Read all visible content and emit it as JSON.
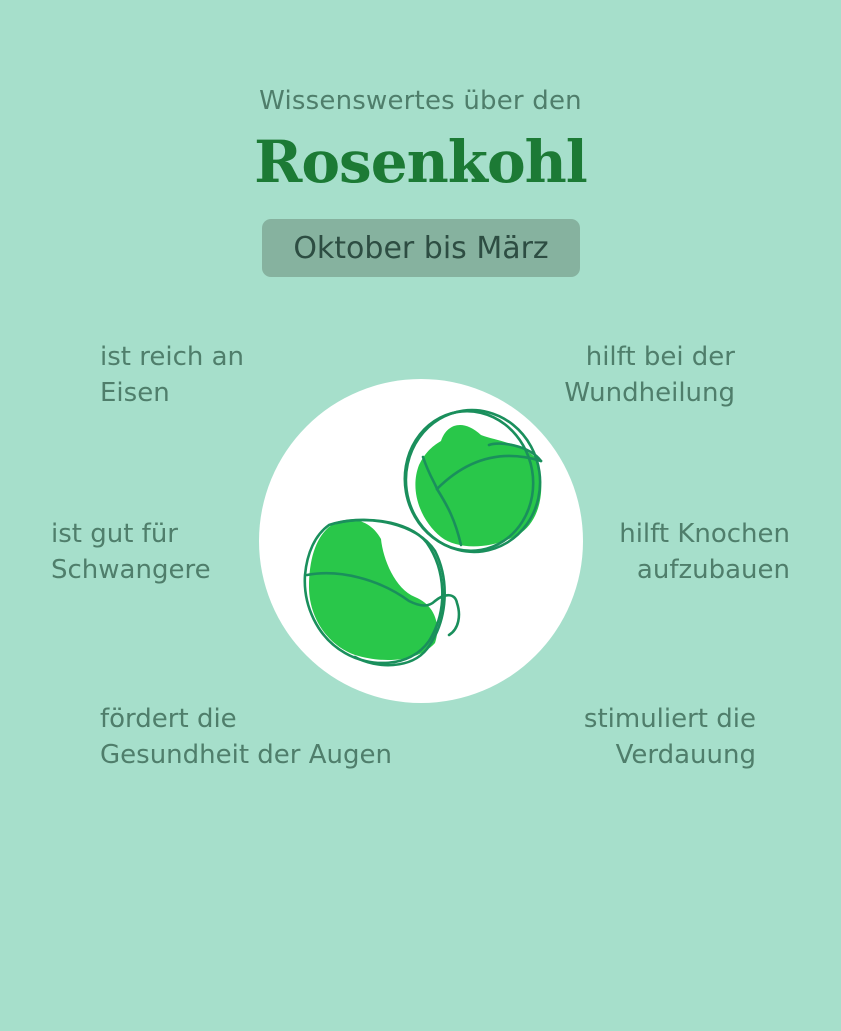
{
  "header": {
    "subtitle": "Wissenswertes über den",
    "title": "Rosenkohl"
  },
  "season": "Oktober bis März",
  "facts": {
    "top_left": [
      "ist reich an",
      "Eisen"
    ],
    "top_right": [
      "hilft bei der",
      "Wundheilung"
    ],
    "mid_left": [
      "ist gut für",
      "Schwangere"
    ],
    "mid_right": [
      "hilft Knochen",
      "aufzubauen"
    ],
    "bottom_left": [
      "fördert die",
      "Gesundheit der Augen"
    ],
    "bottom_right": [
      "stimuliert die",
      "Verdauung"
    ]
  },
  "colors": {
    "background": "#a6dfcb",
    "title": "#1c7a35",
    "text": "#4f7e6b",
    "badge": "#86b29f",
    "sprout_fill": "#29c74a",
    "sprout_outline": "#1a8f5c"
  },
  "illustration": {
    "icon": "brussels-sprouts-icon"
  }
}
